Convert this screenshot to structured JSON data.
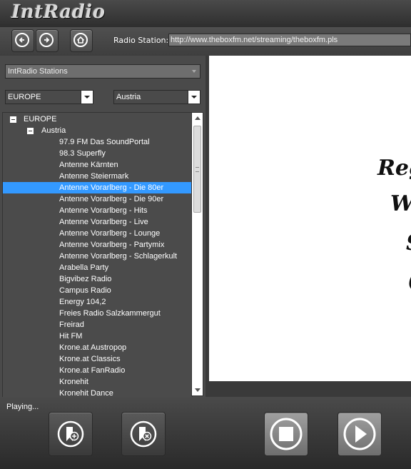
{
  "app": {
    "title": "IntRadio"
  },
  "toolbar": {
    "radio_station_label": "Radio Station:",
    "url_value": "http://www.theboxfm.net/streaming/theboxfm.pls"
  },
  "filters": {
    "source_selected": "IntRadio Stations",
    "continent_selected": "EUROPE",
    "country_selected": "Austria"
  },
  "tree": {
    "root": "EUROPE",
    "country": "Austria",
    "stations": [
      "97.9 FM Das SoundPortal",
      "98.3 Superfly",
      "Antenne Kärnten",
      "Antenne Steiermark",
      "Antenne Vorarlberg - Die 80er",
      "Antenne Vorarlberg - Die 90er",
      "Antenne Vorarlberg - Hits",
      "Antenne Vorarlberg - Live",
      "Antenne Vorarlberg - Lounge",
      "Antenne Vorarlberg - Partymix",
      "Antenne Vorarlberg - Schlagerkult",
      "Arabella Party",
      "Bigvibez Radio",
      "Campus Radio",
      "Energy 104,2",
      "Freies Radio Salzkammergut",
      "Freirad",
      "Hit FM",
      "Krone.at Austropop",
      "Krone.at Classics",
      "Krone.at FanRadio",
      "Kronehit",
      "Kronehit Dance"
    ],
    "selected_index": 4
  },
  "preview": {
    "lines": [
      "Reg",
      "W",
      "S",
      "("
    ]
  },
  "status": {
    "text": "Playing..."
  },
  "icons": {
    "back": "arrow-left-icon",
    "forward": "arrow-right-icon",
    "home": "home-icon",
    "add_favorite": "bookmark-add-icon",
    "remove_favorite": "bookmark-remove-icon",
    "stop": "stop-icon",
    "play": "play-icon"
  },
  "colors": {
    "selection": "#3399ff",
    "panel": "#4a4a4a"
  }
}
